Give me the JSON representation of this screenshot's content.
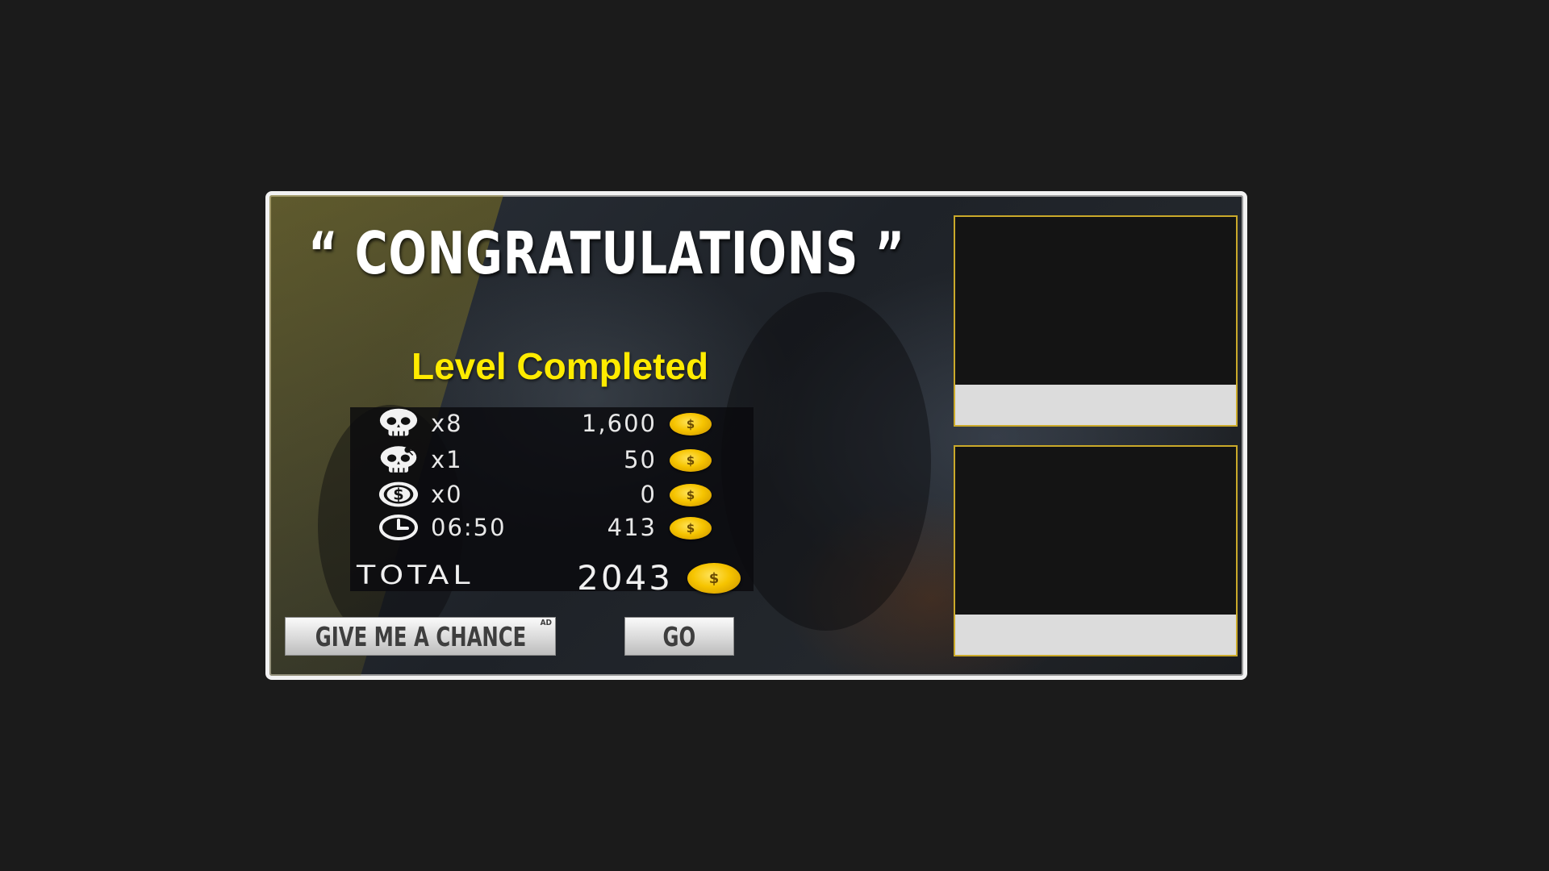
{
  "title": "“ CONGRATULATIONS ”",
  "subtitle": "Level Completed",
  "stats": [
    {
      "icon": "skull-icon",
      "quantity": "x8",
      "reward": "1,600"
    },
    {
      "icon": "headshot-skull-icon",
      "quantity": "x1",
      "reward": "50"
    },
    {
      "icon": "dollar-coin-icon",
      "quantity": "x0",
      "reward": "0"
    },
    {
      "icon": "clock-icon",
      "quantity": "06:50",
      "reward": "413"
    }
  ],
  "total": {
    "label": "TOTAL",
    "value": "2043"
  },
  "coin_symbol": "$",
  "buttons": {
    "chance": "GIVE ME A CHANCE",
    "ad_badge": "AD",
    "go": "GO"
  },
  "colors": {
    "subtitle": "#ffeb00",
    "slot_border": "#caa92a",
    "coin": "#f6c400"
  }
}
